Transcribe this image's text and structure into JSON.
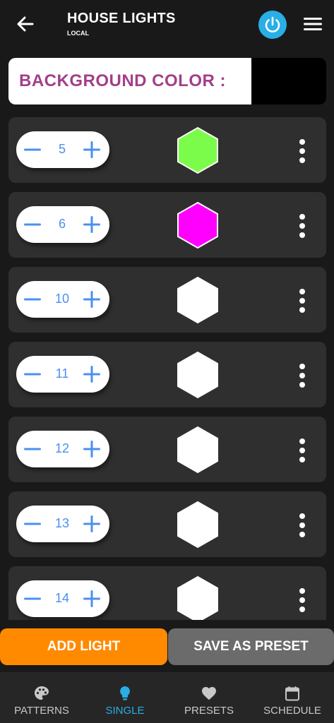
{
  "header": {
    "title": "HOUSE LIGHTS",
    "subtitle": "LOCAL",
    "back_icon": "back-arrow-icon",
    "power_icon": "power-icon",
    "menu_icon": "hamburger-menu-icon",
    "accent": "#29aee6"
  },
  "background": {
    "label": "BACKGROUND COLOR :",
    "color": "#000000"
  },
  "lights": [
    {
      "number": "5",
      "color": "#7cfc4a"
    },
    {
      "number": "6",
      "color": "#ff00ff"
    },
    {
      "number": "10",
      "color": "#ffffff"
    },
    {
      "number": "11",
      "color": "#ffffff"
    },
    {
      "number": "12",
      "color": "#ffffff"
    },
    {
      "number": "13",
      "color": "#ffffff"
    },
    {
      "number": "14",
      "color": "#ffffff"
    }
  ],
  "actions": {
    "add_light": "ADD LIGHT",
    "save_preset": "SAVE AS PRESET",
    "add_color": "#ff8a00",
    "save_color": "#6b6b6b"
  },
  "nav": {
    "items": [
      {
        "label": "PATTERNS",
        "icon": "palette-icon",
        "active": false
      },
      {
        "label": "SINGLE",
        "icon": "lightbulb-icon",
        "active": true
      },
      {
        "label": "PRESETS",
        "icon": "heart-icon",
        "active": false
      },
      {
        "label": "SCHEDULE",
        "icon": "calendar-icon",
        "active": false
      }
    ]
  }
}
